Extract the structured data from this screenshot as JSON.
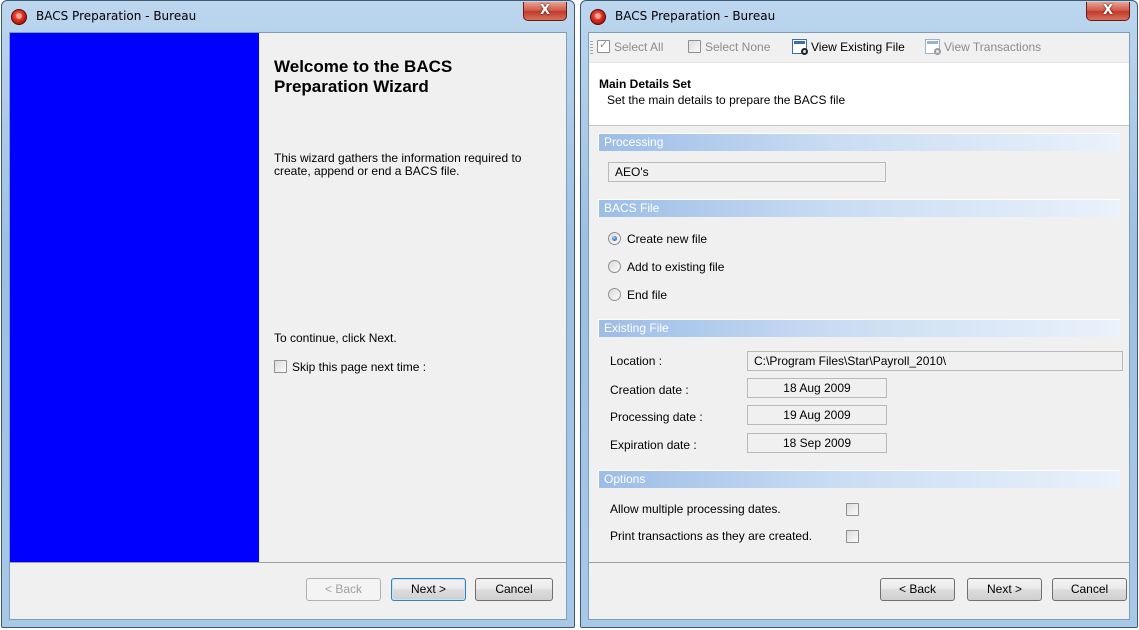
{
  "colors": {
    "wizard_banner": "#0000ff",
    "title_bar": "#a8c8e8",
    "group_header_start": "#9cbde6"
  },
  "windows": [
    {
      "title": "BACS Preparation - Bureau",
      "close_label": "X",
      "welcome_title": "Welcome to the BACS Preparation Wizard",
      "description": "This wizard gathers the information required to\ncreate, append or end a BACS file.",
      "continue_text": "To continue, click Next.",
      "skip_label": "Skip this page next time :",
      "skip_checked": false,
      "buttons": {
        "back": "< Back",
        "next": "Next >",
        "cancel": "Cancel"
      }
    },
    {
      "title": "BACS Preparation - Bureau",
      "close_label": "X",
      "toolbar": {
        "select_all": "Select All",
        "select_none": "Select None",
        "view_existing_file": "View Existing File",
        "view_transactions": "View Transactions"
      },
      "header": {
        "title": "Main Details Set",
        "subtitle": "Set the main details to prepare the BACS file"
      },
      "processing": {
        "heading": "Processing",
        "value": "AEO's"
      },
      "bacs_file": {
        "heading": "BACS File",
        "options": [
          {
            "label": "Create new file",
            "selected": true
          },
          {
            "label": "Add to existing file",
            "selected": false
          },
          {
            "label": "End file",
            "selected": false
          }
        ]
      },
      "existing_file": {
        "heading": "Existing File",
        "location_label": "Location :",
        "location_value": "C:\\Program Files\\Star\\Payroll_2010\\",
        "creation_label": "Creation date :",
        "creation_value": "18 Aug 2009",
        "processing_label": "Processing date :",
        "processing_value": "19 Aug 2009",
        "expiration_label": "Expiration date :",
        "expiration_value": "18 Sep 2009"
      },
      "options": {
        "heading": "Options",
        "allow_multiple": "Allow multiple processing dates.",
        "allow_multiple_checked": false,
        "print_transactions": "Print transactions as they are created.",
        "print_transactions_checked": false
      },
      "buttons": {
        "back": "< Back",
        "next": "Next >",
        "cancel": "Cancel"
      }
    }
  ]
}
